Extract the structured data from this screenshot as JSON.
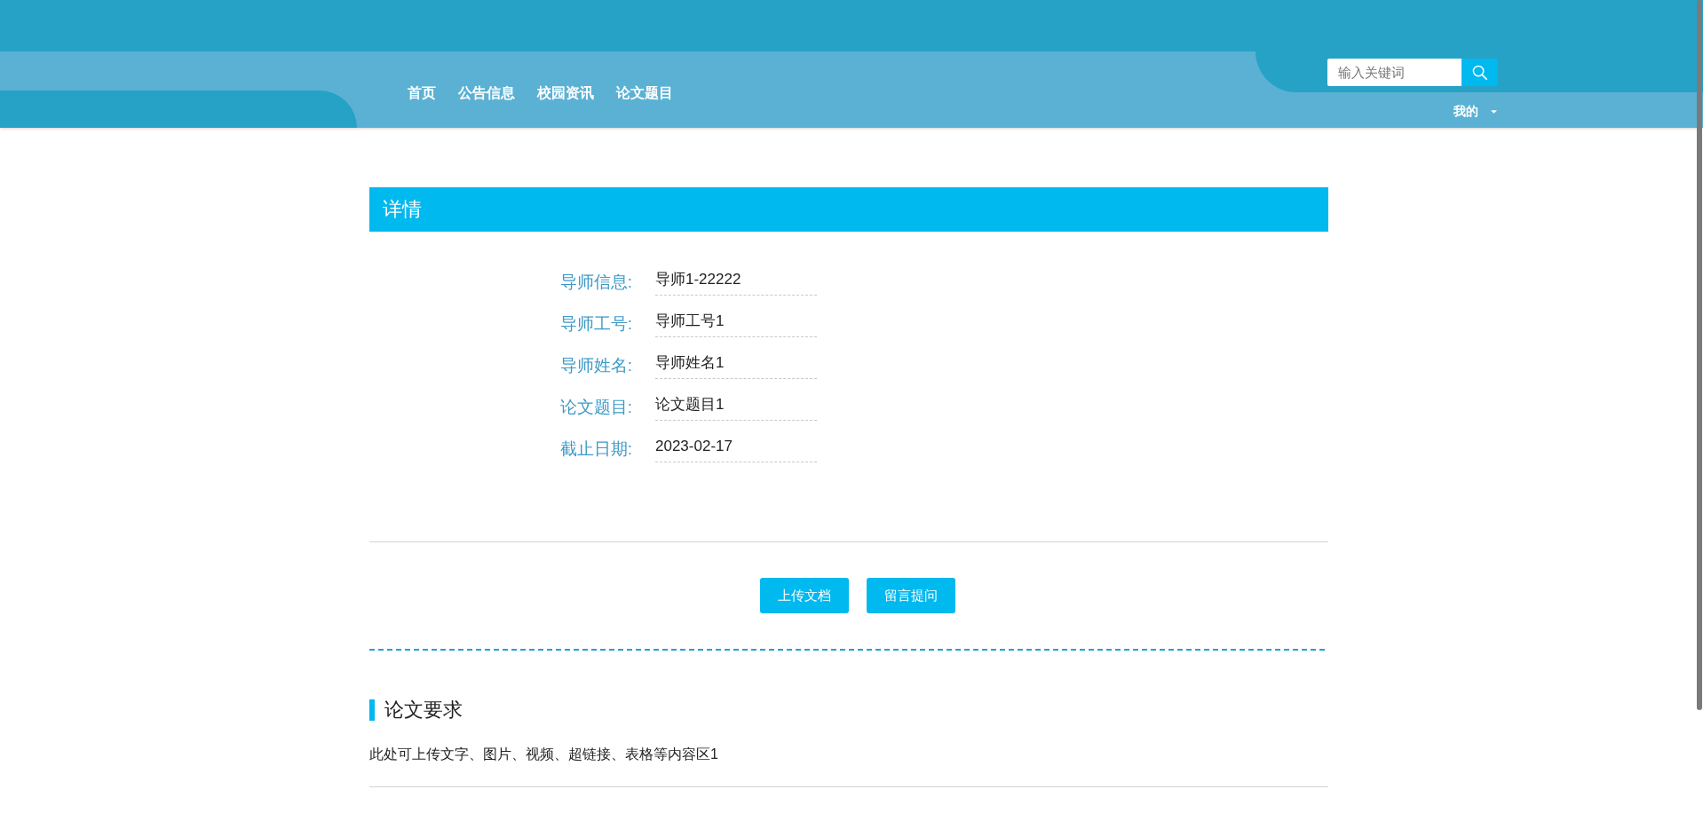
{
  "header": {
    "nav": [
      {
        "label": "首页"
      },
      {
        "label": "公告信息"
      },
      {
        "label": "校园资讯"
      },
      {
        "label": "论文题目"
      }
    ],
    "search": {
      "placeholder": "输入关键词"
    },
    "user_menu": {
      "label": "我的"
    }
  },
  "detail": {
    "title": "详情",
    "fields": [
      {
        "label": "导师信息:",
        "value": "导师1-22222"
      },
      {
        "label": "导师工号:",
        "value": "导师工号1"
      },
      {
        "label": "导师姓名:",
        "value": "导师姓名1"
      },
      {
        "label": "论文题目:",
        "value": "论文题目1"
      },
      {
        "label": "截止日期:",
        "value": "2023-02-17"
      }
    ]
  },
  "actions": [
    "上传文档",
    "留言提问"
  ],
  "requirements": {
    "title": "论文要求",
    "text": "此处可上传文字、图片、视频、超链接、表格等内容区1"
  }
}
